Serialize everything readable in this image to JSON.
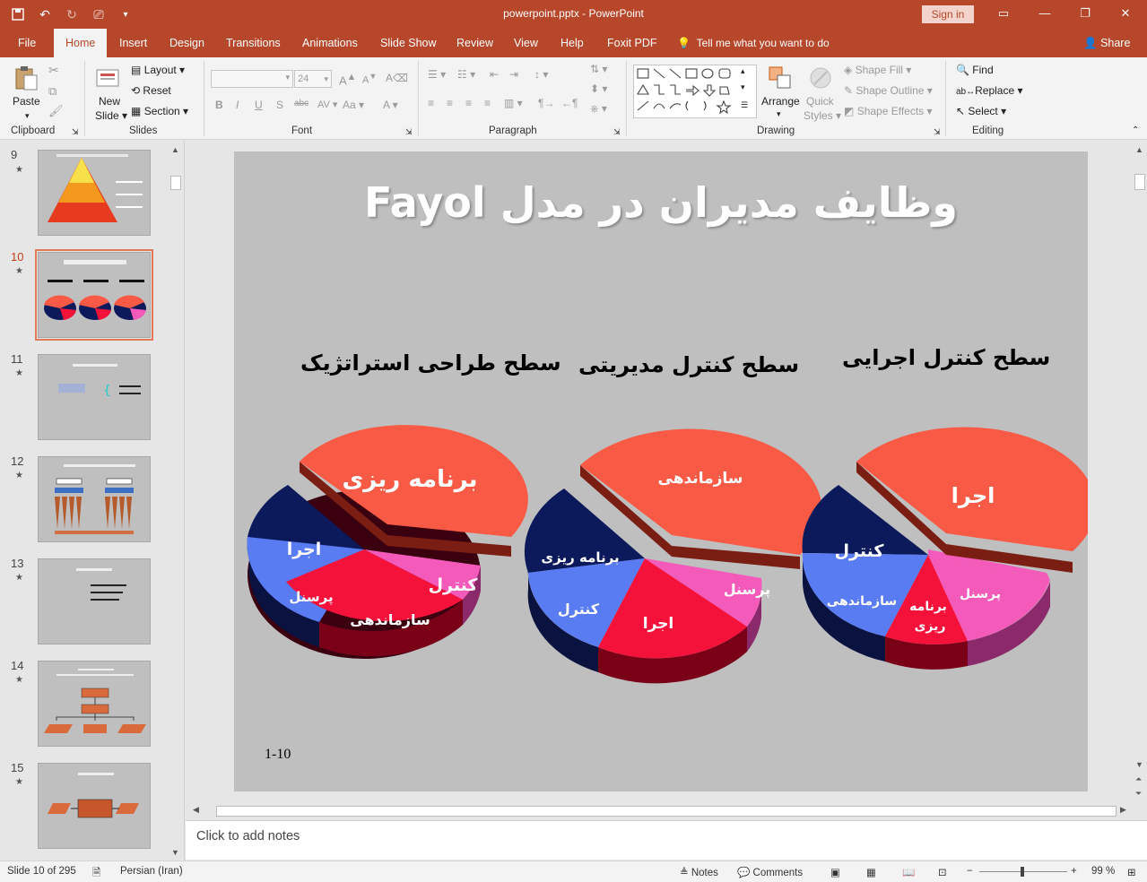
{
  "window": {
    "doc_title": "powerpoint.pptx  -  PowerPoint",
    "signin_label": "Sign in"
  },
  "tabs": [
    "File",
    "Home",
    "Insert",
    "Design",
    "Transitions",
    "Animations",
    "Slide Show",
    "Review",
    "View",
    "Help",
    "Foxit PDF"
  ],
  "tell_me": "Tell me what you want to do",
  "share_label": "Share",
  "ribbon": {
    "clipboard": {
      "paste": "Paste",
      "label": "Clipboard"
    },
    "slides": {
      "new_slide_1": "New",
      "new_slide_2": "Slide",
      "layout": "Layout",
      "reset": "Reset",
      "section": "Section",
      "label": "Slides"
    },
    "font": {
      "size": "24",
      "label": "Font"
    },
    "paragraph": {
      "label": "Paragraph"
    },
    "drawing": {
      "arrange": "Arrange",
      "quick_styles_1": "Quick",
      "quick_styles_2": "Styles",
      "shape_fill": "Shape Fill",
      "shape_outline": "Shape Outline",
      "shape_effects": "Shape Effects",
      "label": "Drawing"
    },
    "editing": {
      "find": "Find",
      "replace": "Replace",
      "select": "Select",
      "label": "Editing"
    }
  },
  "thumbnails": [
    {
      "num": "9",
      "star": "★"
    },
    {
      "num": "10",
      "star": "★"
    },
    {
      "num": "11",
      "star": "★"
    },
    {
      "num": "12",
      "star": "★"
    },
    {
      "num": "13",
      "star": "★"
    },
    {
      "num": "14",
      "star": "★"
    },
    {
      "num": "15",
      "star": "★"
    }
  ],
  "slide": {
    "title": "وظايف مديران در مدل Fayol",
    "levels": [
      "سطح طراحی استراتژيک",
      "سطح  کنترل مديريتی",
      "سطح کنترل اجرايی"
    ],
    "slide_number": "1-10",
    "pies": [
      {
        "big": "برنامه ريزی",
        "slices": [
          "اجرا",
          "پرسنل",
          "سازماندهی",
          "کنترل"
        ]
      },
      {
        "big": "سازماندهی",
        "slices": [
          "برنامه ريزی",
          "کنترل",
          "اجرا",
          "پرسنل"
        ]
      },
      {
        "big": "اجرا",
        "slices": [
          "کنترل",
          "سازماندهی",
          "برنامه",
          "ريزی",
          "پرسنل"
        ]
      }
    ]
  },
  "notes_placeholder": "Click to add notes",
  "status": {
    "slide_info": "Slide 10 of 295",
    "language": "Persian (Iran)",
    "notes": "Notes",
    "comments": "Comments",
    "zoom": "99 %"
  },
  "colors": {
    "accent": "#b7472a",
    "pie_big": "#f85a45",
    "pie_navy": "#0c1a5c",
    "pie_blue": "#5a7cf2",
    "pie_red": "#f5123a",
    "pie_pink": "#f45aba"
  }
}
